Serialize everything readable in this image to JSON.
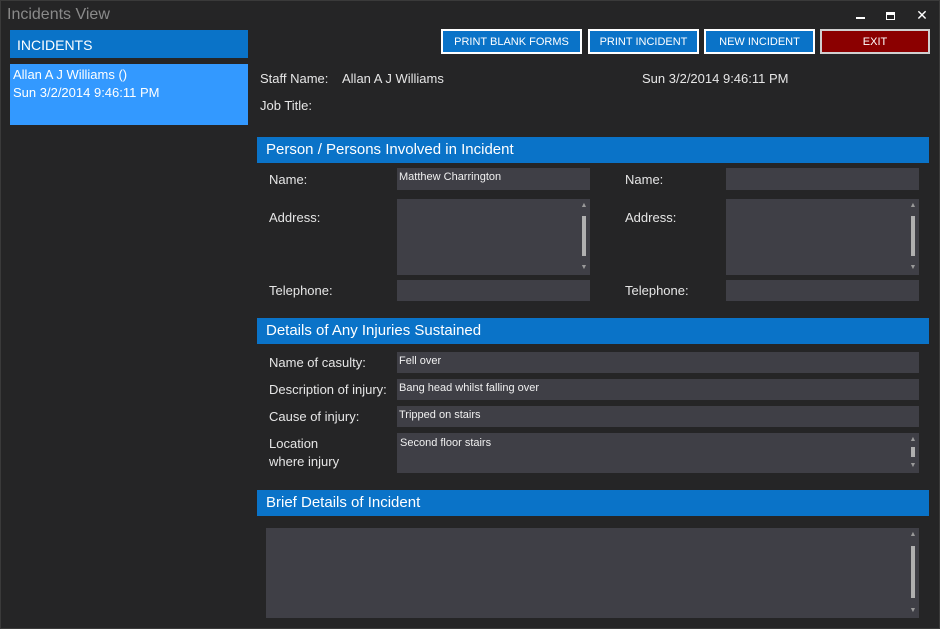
{
  "window": {
    "title": "Incidents View"
  },
  "sidebar": {
    "header": "INCIDENTS",
    "items": [
      {
        "line1": "Allan  A J Williams  ()",
        "line2": "Sun 3/2/2014  9:46:11 PM"
      }
    ]
  },
  "toolbar": {
    "print_blank_forms": "PRINT BLANK FORMS",
    "print_incident": "PRINT INCIDENT",
    "new_incident": "NEW INCIDENT",
    "exit": "EXIT"
  },
  "staff": {
    "name_label": "Staff Name:",
    "name_value": "Allan A J Williams",
    "datetime": "Sun 3/2/2014 9:46:11 PM",
    "job_title_label": "Job Title:"
  },
  "persons": {
    "section_title": "Person / Persons Involved in Incident",
    "name_label": "Name:",
    "address_label": "Address:",
    "telephone_label": "Telephone:",
    "person1": {
      "name": "Matthew Charrington",
      "address": "",
      "telephone": ""
    },
    "person2": {
      "name": "",
      "address": "",
      "telephone": ""
    }
  },
  "injuries": {
    "section_title": "Details of Any Injuries Sustained",
    "casualty_label": "Name of casulty:",
    "casualty_value": "Fell over",
    "description_label": "Description of injury:",
    "description_value": "Bang head whilst falling over",
    "cause_label": "Cause of injury:",
    "cause_value": "Tripped on stairs",
    "location_label_1": "Location",
    "location_label_2": "where injury",
    "location_value": "Second floor stairs"
  },
  "details": {
    "section_title": "Brief Details of Incident",
    "value": ""
  },
  "colors": {
    "accent": "#0a73c8",
    "selected_item": "#3399ff",
    "exit_button": "#8b0000",
    "background": "#252526",
    "field": "#3f3f46"
  }
}
